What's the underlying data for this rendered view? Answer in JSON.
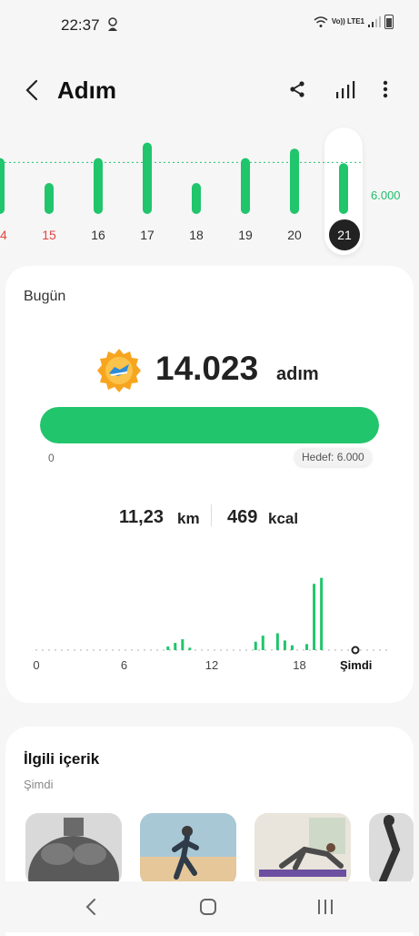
{
  "status": {
    "time": "22:37",
    "network": "Vo)) LTE1"
  },
  "header": {
    "title": "Adım"
  },
  "week": {
    "days": [
      {
        "label": "14",
        "weekend": true
      },
      {
        "label": "15",
        "weekend": true
      },
      {
        "label": "16",
        "weekend": false
      },
      {
        "label": "17",
        "weekend": false
      },
      {
        "label": "18",
        "weekend": false
      },
      {
        "label": "19",
        "weekend": false
      },
      {
        "label": "20",
        "weekend": false
      },
      {
        "label": "21",
        "weekend": false,
        "selected": true
      }
    ],
    "goal_label": "6.000"
  },
  "today": {
    "label": "Bugün",
    "steps": "14.023",
    "steps_unit": "adım",
    "progress_fraction": 1.0,
    "progress_min": "0",
    "progress_goal": "Hedef: 6.000",
    "distance_value": "11,23",
    "distance_unit": "km",
    "calories_value": "469",
    "calories_unit": "kcal",
    "hour_ticks": [
      "0",
      "6",
      "12",
      "18"
    ],
    "now_label": "Şimdi"
  },
  "chart_data": [
    {
      "type": "bar",
      "title": "",
      "categories": [
        "14",
        "15",
        "16",
        "17",
        "18",
        "19",
        "20",
        "21"
      ],
      "values": [
        6500,
        3600,
        6500,
        8300,
        3600,
        6500,
        7600,
        5900
      ],
      "goal": 6000,
      "ylim": [
        0,
        9000
      ]
    },
    {
      "type": "bar",
      "title": "",
      "x": [
        9,
        9.5,
        10,
        10.5,
        15,
        15.5,
        16.5,
        17,
        17.5,
        18.5,
        19,
        19.5
      ],
      "values": [
        300,
        600,
        900,
        200,
        700,
        1200,
        1400,
        800,
        400,
        500,
        5500,
        6000
      ],
      "xlim": [
        0,
        24
      ]
    }
  ],
  "related": {
    "title": "İlgili içerik",
    "subtitle": "Şimdi"
  },
  "colors": {
    "accent": "#20c56c",
    "weekend": "#e2463f",
    "track": "#e4e4e4"
  }
}
